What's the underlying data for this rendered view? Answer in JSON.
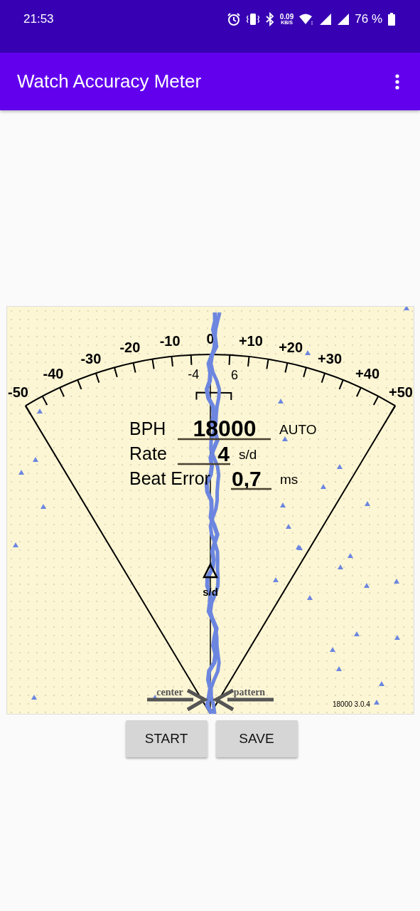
{
  "status_bar": {
    "time": "21:53",
    "net_speed": "0.09",
    "net_unit": "KB/S",
    "battery": "76 %"
  },
  "app_bar": {
    "title": "Watch Accuracy Meter"
  },
  "meter": {
    "scale_labels": [
      "-50",
      "-40",
      "-30",
      "-20",
      "-10",
      "0",
      "+10",
      "+20",
      "+30",
      "+40",
      "+50"
    ],
    "bracket": {
      "low": "-4",
      "high": "6"
    },
    "readouts": [
      {
        "label": "BPH",
        "value": "18000",
        "unit": "AUTO"
      },
      {
        "label": "Rate",
        "value": "4",
        "unit": "s/d"
      },
      {
        "label": "Beat Error",
        "value": "0,7",
        "unit": "ms"
      }
    ],
    "marker_label": "s/d",
    "center_label": "center",
    "pattern_label": "pattern",
    "footer": "18000 3.0.4"
  },
  "buttons": [
    "START",
    "SAVE"
  ]
}
